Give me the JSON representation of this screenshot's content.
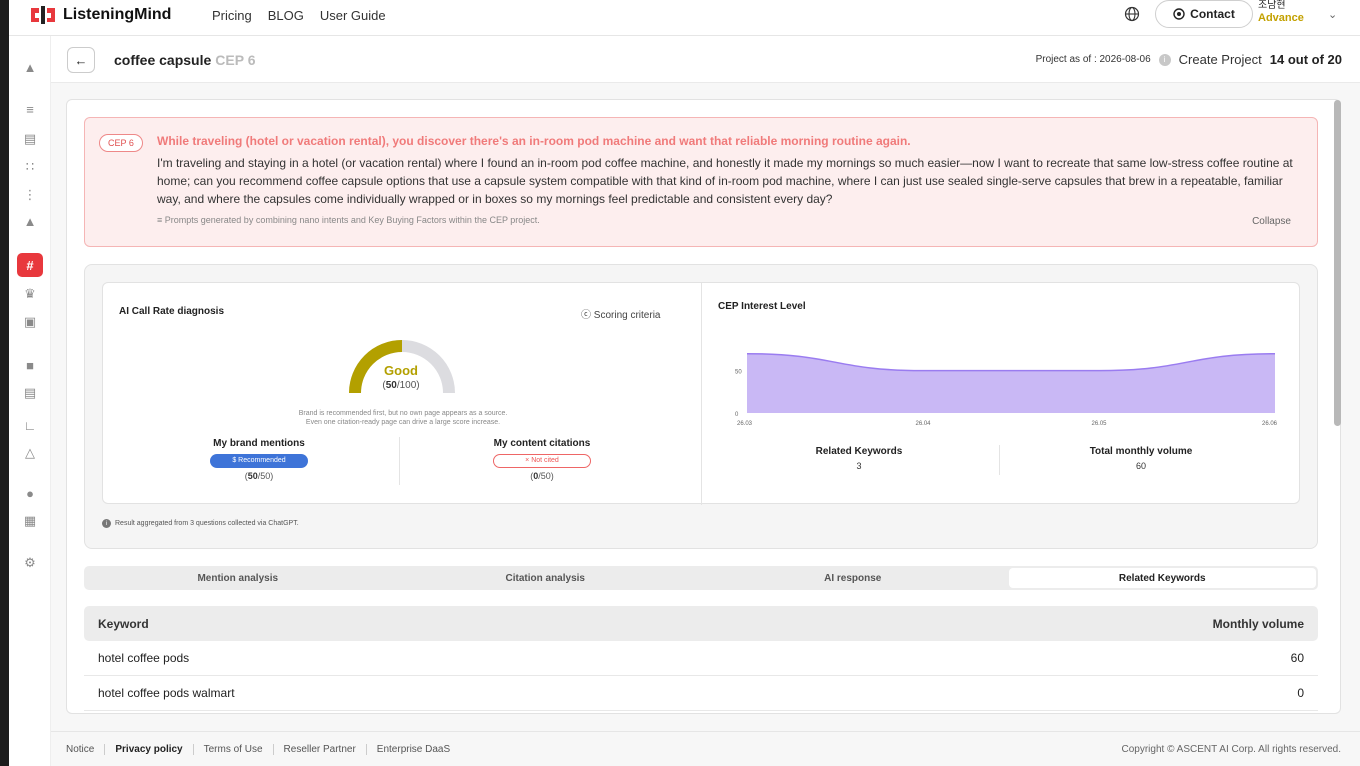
{
  "nav": {
    "logo": "ListeningMind",
    "links": [
      "Pricing",
      "BLOG",
      "User Guide"
    ],
    "contact": "Contact",
    "user_name": "조남현",
    "user_plan": "Advance"
  },
  "header": {
    "title": "coffee capsule",
    "cep_label": "CEP 6",
    "project_as_of": "Project as of : 2026-08-06",
    "create_project": "Create Project",
    "count": "14 out of 20"
  },
  "cep": {
    "tag": "CEP 6",
    "headline": "While traveling (hotel or vacation rental), you discover there's an in-room pod machine and want that reliable morning routine again.",
    "body": "I'm traveling and staying in a hotel (or vacation rental) where I found an in-room pod coffee machine, and honestly it made my mornings so much easier—now I want to recreate that same low-stress coffee routine at home; can you recommend coffee capsule options that use a capsule system compatible with that kind of in-room pod machine, where I can just use sealed single-serve capsules that brew in a repeatable, familiar way, and where the capsules come individually wrapped or in boxes so my mornings feel predictable and consistent every day?",
    "note": "Prompts generated by combining nano intents and Key Buying Factors within the CEP project.",
    "collapse": "Collapse"
  },
  "diagnosis": {
    "title": "AI Call Rate diagnosis",
    "scoring": "Scoring criteria",
    "grade": "Good",
    "score": 50,
    "score_max": "/100",
    "score_color": "#b3a000",
    "desc_line1": "Brand is recommended first, but no own page appears as a source.",
    "desc_line2": "Even one citation-ready page can drive a large score increase.",
    "mentions_label": "My brand mentions",
    "mentions_badge": "$ Recommended",
    "mentions_score": "50",
    "mentions_max": "/50",
    "citations_label": "My content citations",
    "citations_badge": "× Not cited",
    "citations_score": "0",
    "citations_max": "/50",
    "aggregate_note": "Result aggregated from 3 questions collected via ChatGPT."
  },
  "interest": {
    "title": "CEP Interest Level",
    "related_label": "Related Keywords",
    "related_value": "3",
    "volume_label": "Total monthly volume",
    "volume_value": "60"
  },
  "chart_data": {
    "type": "area",
    "title": "CEP Interest Level",
    "x": [
      "26.03",
      "26.04",
      "26.05",
      "26.06"
    ],
    "series": [
      {
        "values": [
          70,
          50,
          50,
          70
        ]
      }
    ],
    "y_ticks": [
      "0",
      "50"
    ],
    "ylim": [
      0,
      85
    ],
    "color": "#c9b8f5",
    "line_color": "#9a7cf0",
    "grid": false
  },
  "tabs": [
    "Mention analysis",
    "Citation analysis",
    "AI response",
    "Related Keywords"
  ],
  "table": {
    "headers": [
      "Keyword",
      "Monthly volume"
    ],
    "rows": [
      {
        "keyword": "hotel coffee pods",
        "volume": "60"
      },
      {
        "keyword": "hotel coffee pods walmart",
        "volume": "0"
      }
    ]
  },
  "footer": {
    "links": [
      "Notice",
      "Privacy policy",
      "Terms of Use",
      "Reseller Partner",
      "Enterprise DaaS"
    ],
    "copyright": "Copyright © ASCENT AI Corp. All rights reserved."
  },
  "colors": {
    "accent": "#e8383d",
    "plan": "#c3a100"
  }
}
